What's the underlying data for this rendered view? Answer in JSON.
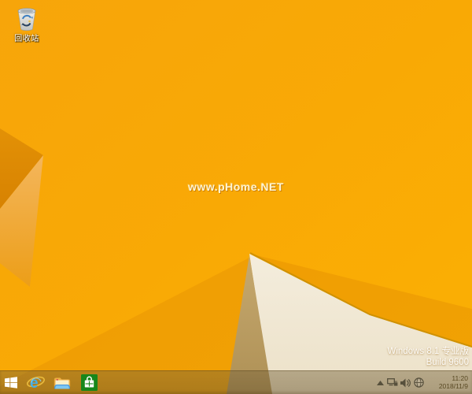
{
  "desktop": {
    "recycle_bin": {
      "label": "回收站"
    },
    "watermark": "www.pHome.NET",
    "system_info": {
      "edition": "Windows 8.1 专业版",
      "build": "Build 9600"
    },
    "wallpaper_colors": {
      "base": "#F9A905",
      "dark_fold": "#DD8A02",
      "sand_fold": "#F2B14E",
      "cream_fold": "#F1E9D7",
      "khaki_shadow": "#B79A5E",
      "edge_line": "#C98E03"
    }
  },
  "taskbar": {
    "buttons": [
      {
        "name": "start",
        "icon": "windows-logo-icon"
      },
      {
        "name": "internet-explorer",
        "icon": "ie-e-icon"
      },
      {
        "name": "file-explorer",
        "icon": "folder-icon"
      },
      {
        "name": "windows-store",
        "icon": "store-bag-icon"
      }
    ],
    "tray": {
      "icons": [
        "show-hidden-icons-icon",
        "network-icon",
        "volume-icon",
        "input-globe-icon"
      ],
      "clock": {
        "time": "11:20",
        "date": "2018/11/9"
      }
    },
    "colors": {
      "store_green": "#17871B",
      "ie_blue": "#45AEE8",
      "folder_gold": "#EFAF45",
      "explorer_base_blue": "#4A9BE0",
      "tray_glyph": "#57503C"
    }
  }
}
